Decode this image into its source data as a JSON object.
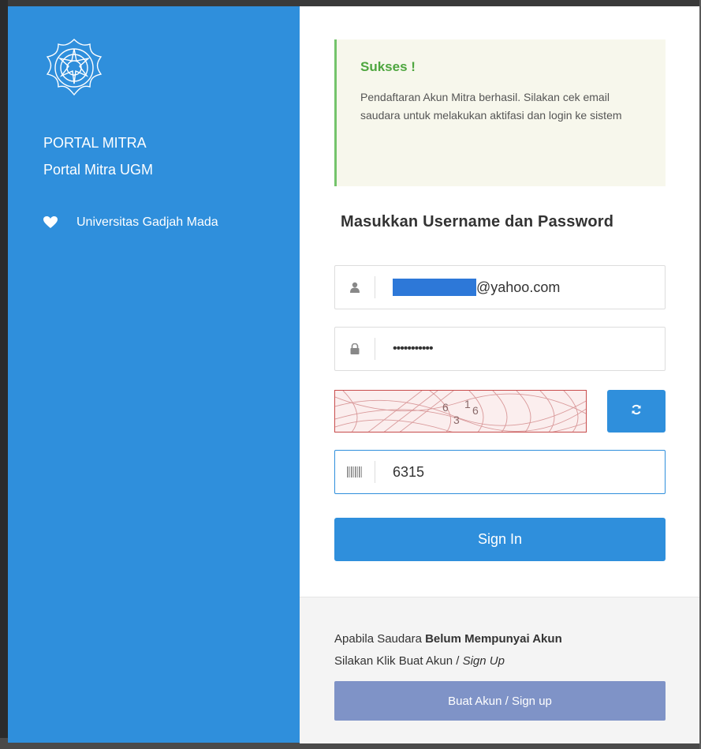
{
  "sidebar": {
    "logo": "ugm-seal-logo",
    "title": "PORTAL MITRA",
    "subtitle": "Portal Mitra UGM",
    "link_icon": "heart-icon",
    "link_label": "Universitas Gadjah Mada"
  },
  "alert": {
    "title": "Sukses !",
    "message": "Pendaftaran Akun Mitra berhasil. Silakan cek email saudara untuk melakukan aktifasi dan login ke sistem"
  },
  "form": {
    "heading": "Masukkan Username dan Password",
    "username": {
      "icon": "user-icon",
      "value_visible": "@yahoo.com"
    },
    "password": {
      "icon": "lock-icon",
      "value": "•••••••••••"
    },
    "captcha": {
      "image_text": "6316",
      "refresh_icon": "refresh-icon"
    },
    "captcha_input": {
      "icon": "barcode-icon",
      "value": "6315"
    },
    "signin_label": "Sign In"
  },
  "footer": {
    "line1_prefix": "Apabila Saudara ",
    "line1_bold": "Belum Mempunyai Akun",
    "line2_prefix": "Silakan Klik Buat Akun / ",
    "line2_italic": "Sign Up",
    "signup_label": "Buat Akun / Sign up"
  },
  "colors": {
    "sidebar": "#2f8fdc",
    "primary_button": "#2f8fdc",
    "signup_button": "#7f93c7",
    "alert_bg": "#f7f7ec",
    "alert_accent": "#74c46b",
    "success_text": "#4ea63f"
  }
}
